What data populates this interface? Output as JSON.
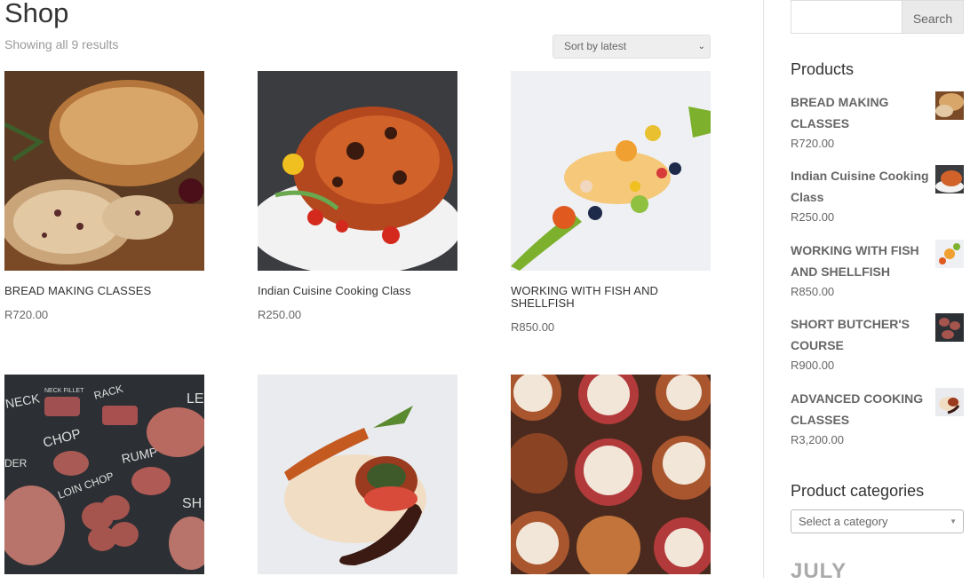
{
  "page": {
    "title": "Shop",
    "result_count": "Showing all 9 results"
  },
  "sort": {
    "selected": "Sort by latest"
  },
  "products": [
    {
      "title": "BREAD MAKING CLASSES",
      "price": "R720.00"
    },
    {
      "title": "Indian Cuisine Cooking Class",
      "price": "R250.00"
    },
    {
      "title": "WORKING WITH FISH AND SHELLFISH",
      "price": "R850.00"
    },
    {
      "title": "",
      "price": ""
    },
    {
      "title": "",
      "price": ""
    },
    {
      "title": "",
      "price": ""
    }
  ],
  "butcher_labels": {
    "a": "NECK",
    "b": "NECK FILLET",
    "c": "RACK",
    "d": "LE",
    "e": "CHOP",
    "f": "RUMP",
    "g": "LOIN CHOP",
    "h": "SH",
    "i": "DER"
  },
  "sidebar": {
    "search_button": "Search",
    "products_title": "Products",
    "products": [
      {
        "name": "BREAD MAKING CLASSES",
        "price": "R720.00"
      },
      {
        "name": "Indian Cuisine Cooking Class",
        "price": "R250.00"
      },
      {
        "name": "WORKING WITH FISH AND SHELLFISH",
        "price": "R850.00"
      },
      {
        "name": "SHORT BUTCHER'S COURSE",
        "price": "R900.00"
      },
      {
        "name": "ADVANCED COOKING CLASSES",
        "price": "R3,200.00"
      }
    ],
    "categories_title": "Product categories",
    "category_placeholder": "Select a category",
    "archive_partial": "JULY"
  },
  "colors": {
    "accent": "#333333",
    "muted": "#666666",
    "sidebar_divider": "#e2e2e2"
  }
}
